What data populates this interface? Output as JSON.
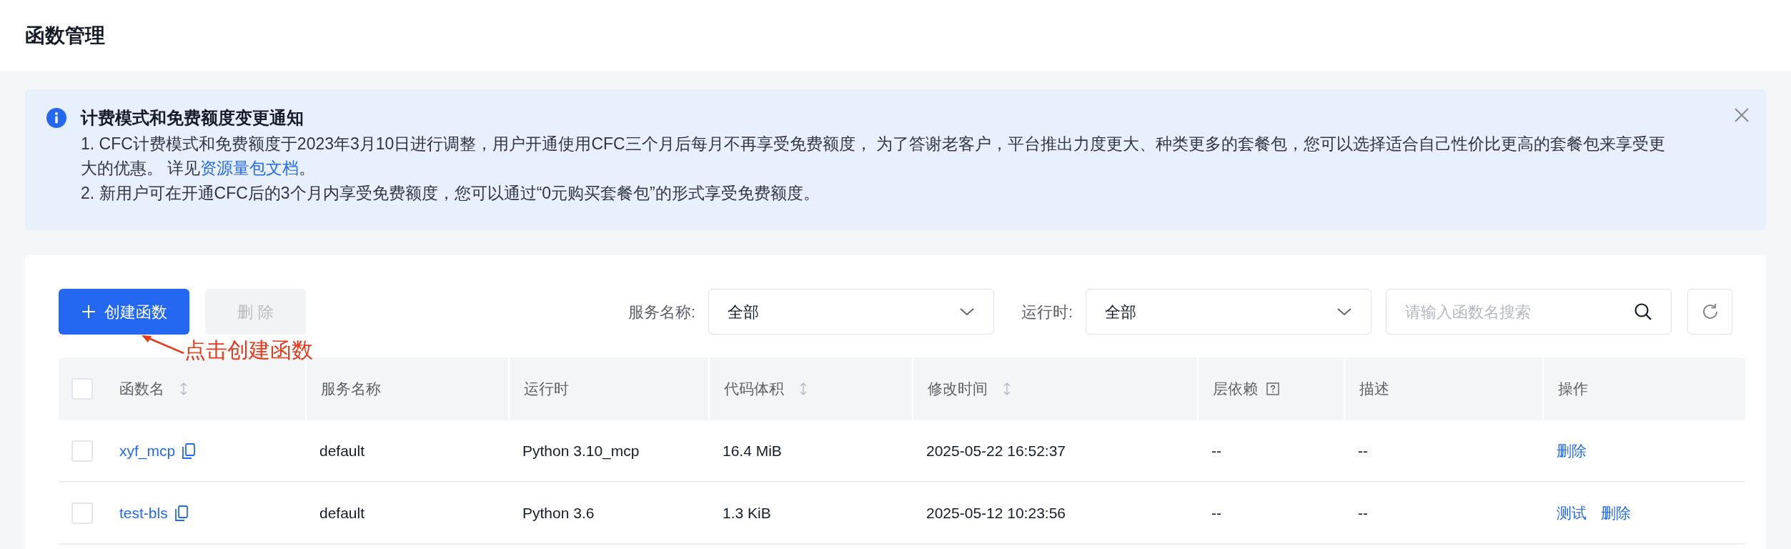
{
  "page": {
    "title": "函数管理"
  },
  "notice": {
    "title": "计费模式和免费额度变更通知",
    "items": [
      {
        "text": "1. CFC计费模式和免费额度于2023年3月10日进行调整，用户开通使用CFC三个月后每月不再享受免费额度， 为了答谢老客户，平台推出力度更大、种类更多的套餐包，您可以选择适合自己性价比更高的套餐包来享受更大的优惠。 详见",
        "link": "资源量包文档",
        "after": "。"
      },
      {
        "text": "2. 新用户可在开通CFC后的3个月内享受免费额度，您可以通过“0元购买套餐包”的形式享受免费额度。"
      }
    ]
  },
  "toolbar": {
    "create_button": "创建函数",
    "delete_button": {
      "label": "删 除",
      "disabled": true
    },
    "filters": [
      {
        "label": "服务名称:",
        "value": "全部"
      },
      {
        "label": "运行时:",
        "value": "全部"
      }
    ],
    "search": {
      "placeholder": "请输入函数名搜索"
    }
  },
  "annotation": {
    "text": "点击创建函数"
  },
  "table": {
    "select_all_checked": false,
    "columns": [
      {
        "label": "函数名",
        "kind": "sortable"
      },
      {
        "label": "服务名称",
        "kind": "plain"
      },
      {
        "label": "运行时",
        "kind": "plain"
      },
      {
        "label": "代码体积",
        "kind": "sortable"
      },
      {
        "label": "修改时间",
        "kind": "sortable"
      },
      {
        "label": "层依赖",
        "kind": "help"
      },
      {
        "label": "描述",
        "kind": "plain"
      },
      {
        "label": "操作",
        "kind": "plain"
      }
    ],
    "rows": [
      {
        "checked": false,
        "name": "xyf_mcp",
        "service": "default",
        "runtime": "Python 3.10_mcp",
        "size": "16.4 MiB",
        "modified": "2025-05-22 16:52:37",
        "layers": "--",
        "description": "--",
        "actions": [
          "删除"
        ]
      },
      {
        "checked": false,
        "name": "test-bls",
        "service": "default",
        "runtime": "Python 3.6",
        "size": "1.3 KiB",
        "modified": "2025-05-12 10:23:56",
        "layers": "--",
        "description": "--",
        "actions": [
          "测试",
          "删除"
        ]
      }
    ]
  }
}
